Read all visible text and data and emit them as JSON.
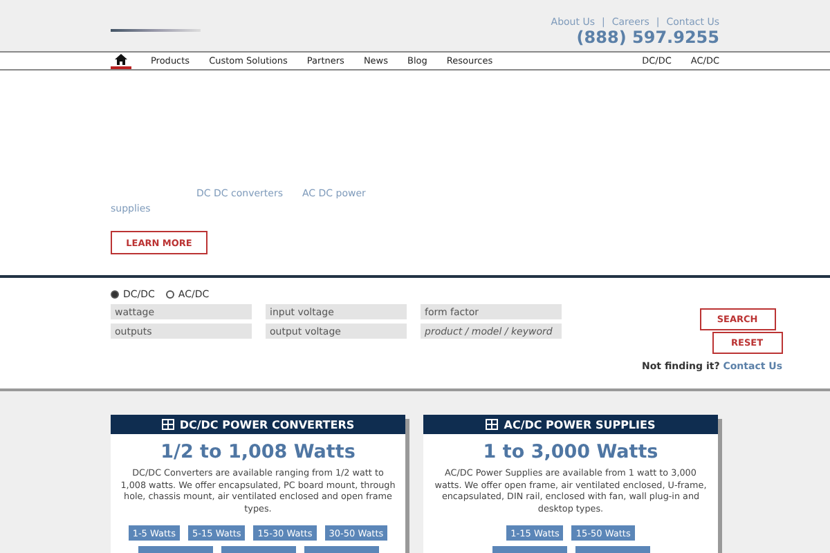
{
  "top_links": [
    "About Us",
    "Careers",
    "Contact Us"
  ],
  "top_link_separator": "|",
  "phone": "(888) 597.9255",
  "nav": [
    {
      "label": "Products",
      "selected": false
    },
    {
      "label": "Custom Solutions",
      "selected": false
    },
    {
      "label": "Partners",
      "selected": false
    },
    {
      "label": "News",
      "selected": false
    },
    {
      "label": "Blog",
      "selected": false
    },
    {
      "label": "Resources",
      "selected": false
    }
  ],
  "home_selected": true,
  "nav_right": [
    "DC/DC",
    "AC/DC"
  ],
  "hero": {
    "links": [
      "DC DC converters",
      "AC DC power",
      "supplies"
    ],
    "button": "LEARN MORE"
  },
  "search": {
    "radios": [
      {
        "label": "DC/DC",
        "selected": true
      },
      {
        "label": "AC/DC",
        "selected": false
      }
    ],
    "fields": [
      {
        "placeholder": "wattage",
        "kind": "select"
      },
      {
        "placeholder": "input voltage",
        "kind": "select"
      },
      {
        "placeholder": "form factor",
        "kind": "select"
      },
      {
        "placeholder": "outputs",
        "kind": "select"
      },
      {
        "placeholder": "output voltage",
        "kind": "select"
      },
      {
        "placeholder": "product / model / keyword",
        "kind": "text"
      }
    ],
    "search_button": "SEARCH",
    "reset_button": "RESET",
    "help_text": "Not finding it?",
    "help_link": "Contact Us"
  },
  "cards": [
    {
      "title": "DC/DC POWER CONVERTERS",
      "range": "1/2 to 1,008 Watts",
      "description": "DC/DC Converters are available ranging from 1/2 watt to 1,008 watts. We offer encapsulated, PC board mount, through hole, chassis mount, air ventilated enclosed and open frame types.",
      "buttons": [
        "1-5 Watts",
        "5-15 Watts",
        "15-30 Watts",
        "30-50 Watts"
      ]
    },
    {
      "title": "AC/DC POWER SUPPLIES",
      "range": "1 to 3,000 Watts",
      "description": "AC/DC Power Supplies are available from 1 watt to 3,000 watts. We offer open frame, air ventilated enclosed, U-frame, encapsulated, DIN rail, enclosed with fan, wall plug-in and desktop types.",
      "buttons": [
        "1-15 Watts",
        "15-50 Watts"
      ]
    }
  ]
}
